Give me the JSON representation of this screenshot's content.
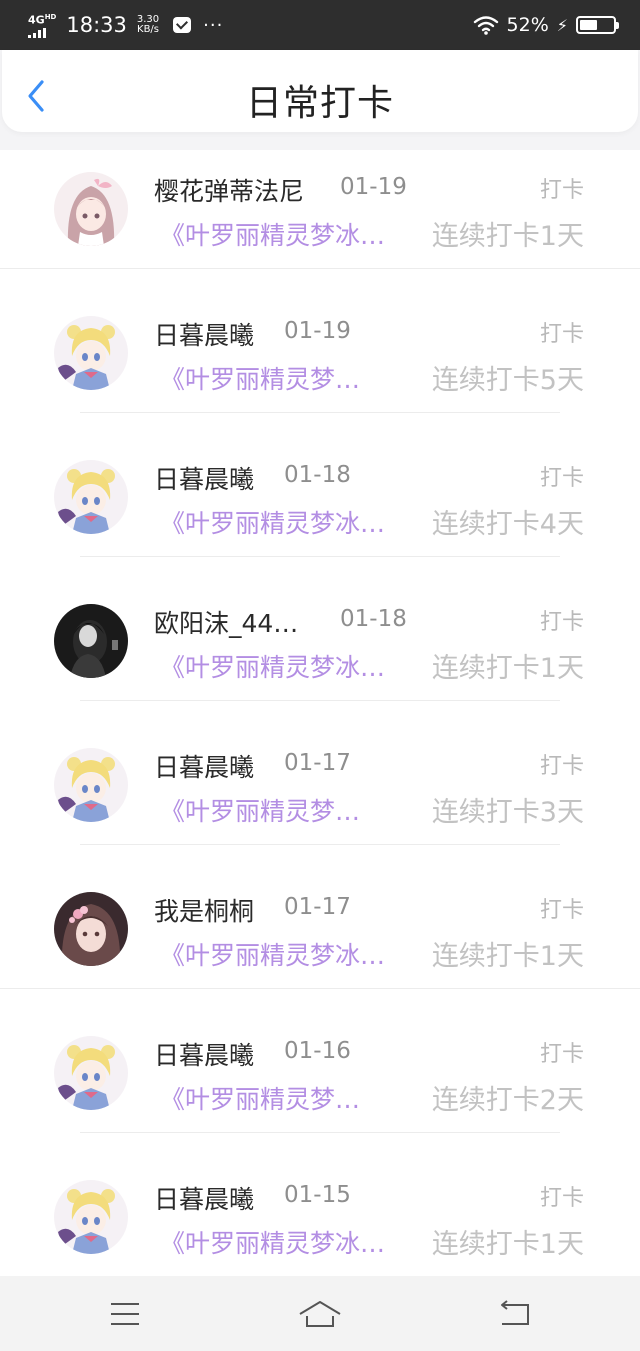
{
  "status_bar": {
    "network": "4G",
    "network_sup": "HD",
    "time": "18:33",
    "speed_value": "3.30",
    "speed_unit": "KB/s",
    "more": "···",
    "battery_percent": "52%",
    "battery_level": 0.52
  },
  "header": {
    "title": "日常打卡",
    "back_icon": "chevron-left-icon"
  },
  "checkins": [
    {
      "user": "樱花弹蒂法尼",
      "date": "01-19",
      "action": "打卡",
      "book": "《叶罗丽精灵梦冰…",
      "streak": "连续打卡1天"
    },
    {
      "user": "日暮晨曦",
      "date": "01-19",
      "action": "打卡",
      "book": "《叶罗丽精灵梦…",
      "streak": "连续打卡5天"
    },
    {
      "user": "日暮晨曦",
      "date": "01-18",
      "action": "打卡",
      "book": "《叶罗丽精灵梦冰…",
      "streak": "连续打卡4天"
    },
    {
      "user": "欧阳沫_44…",
      "date": "01-18",
      "action": "打卡",
      "book": "《叶罗丽精灵梦冰…",
      "streak": "连续打卡1天"
    },
    {
      "user": "日暮晨曦",
      "date": "01-17",
      "action": "打卡",
      "book": "《叶罗丽精灵梦…",
      "streak": "连续打卡3天"
    },
    {
      "user": "我是桐桐",
      "date": "01-17",
      "action": "打卡",
      "book": "《叶罗丽精灵梦冰…",
      "streak": "连续打卡1天"
    },
    {
      "user": "日暮晨曦",
      "date": "01-16",
      "action": "打卡",
      "book": "《叶罗丽精灵梦…",
      "streak": "连续打卡2天"
    },
    {
      "user": "日暮晨曦",
      "date": "01-15",
      "action": "打卡",
      "book": "《叶罗丽精灵梦冰…",
      "streak": "连续打卡1天"
    }
  ],
  "colors": {
    "accent_back": "#3a8ef6",
    "book_text": "#b38ee3",
    "streak_text": "#c2c2c2"
  },
  "nav_bar": {
    "menu_icon": "menu-icon",
    "home_icon": "home-icon",
    "back_icon": "return-icon"
  }
}
